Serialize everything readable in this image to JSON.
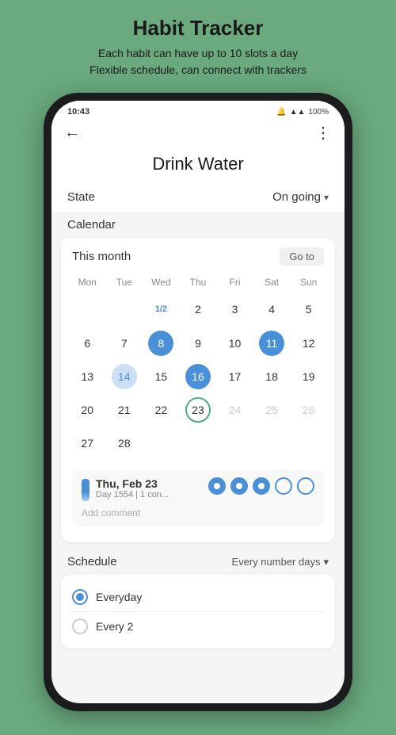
{
  "appTitle": "Habit Tracker",
  "appSubtitle": "Each habit can have up to 10 slots a day\nFlexible schedule, can connect with trackers",
  "statusBar": {
    "time": "10:43",
    "battery": "100%"
  },
  "header": {
    "title": "Drink Water",
    "backIcon": "←",
    "moreIcon": "⋮"
  },
  "stateSection": {
    "label": "State",
    "value": "On going",
    "dropdownIcon": "▾"
  },
  "calendarSection": {
    "label": "Calendar",
    "header": "This month",
    "goToBtn": "Go to",
    "weekdays": [
      "Mon",
      "Tue",
      "Wed",
      "Thu",
      "Fri",
      "Sat",
      "Sun"
    ],
    "rows": [
      [
        {
          "num": "",
          "style": "empty"
        },
        {
          "num": "",
          "style": "empty"
        },
        {
          "num": "1/2",
          "style": "wed-special"
        },
        {
          "num": "2",
          "style": "normal"
        },
        {
          "num": "3",
          "style": "normal"
        },
        {
          "num": "4",
          "style": "normal"
        },
        {
          "num": "5",
          "style": "normal"
        }
      ],
      [
        {
          "num": "6",
          "style": "normal"
        },
        {
          "num": "7",
          "style": "normal"
        },
        {
          "num": "8",
          "style": "filled-full"
        },
        {
          "num": "9",
          "style": "normal"
        },
        {
          "num": "10",
          "style": "normal"
        },
        {
          "num": "11",
          "style": "filled-full"
        },
        {
          "num": "12",
          "style": "normal"
        }
      ],
      [
        {
          "num": "13",
          "style": "normal"
        },
        {
          "num": "14",
          "style": "filled-half"
        },
        {
          "num": "15",
          "style": "normal"
        },
        {
          "num": "16",
          "style": "filled-full"
        },
        {
          "num": "17",
          "style": "normal"
        },
        {
          "num": "18",
          "style": "normal"
        },
        {
          "num": "19",
          "style": "normal"
        }
      ],
      [
        {
          "num": "20",
          "style": "normal"
        },
        {
          "num": "21",
          "style": "normal"
        },
        {
          "num": "22",
          "style": "normal"
        },
        {
          "num": "23",
          "style": "today-outline"
        },
        {
          "num": "24",
          "style": "dim"
        },
        {
          "num": "25",
          "style": "dim"
        },
        {
          "num": "26",
          "style": "dim"
        }
      ],
      [
        {
          "num": "27",
          "style": "normal"
        },
        {
          "num": "28",
          "style": "normal"
        },
        {
          "num": "",
          "style": "empty"
        },
        {
          "num": "",
          "style": "empty"
        },
        {
          "num": "",
          "style": "empty"
        },
        {
          "num": "",
          "style": "empty"
        },
        {
          "num": "",
          "style": "empty"
        }
      ]
    ]
  },
  "dayDetail": {
    "dateLabel": "Thu, Feb 23",
    "subLabel": "Day 1554 | 1 con...",
    "dotsCount": 5,
    "filledDots": 3,
    "addCommentPlaceholder": "Add comment"
  },
  "scheduleSection": {
    "label": "Schedule",
    "value": "Every number days",
    "dropdownIcon": "▾",
    "options": [
      {
        "label": "Everyday",
        "selected": true
      },
      {
        "label": "Every  2",
        "selected": false
      }
    ]
  }
}
